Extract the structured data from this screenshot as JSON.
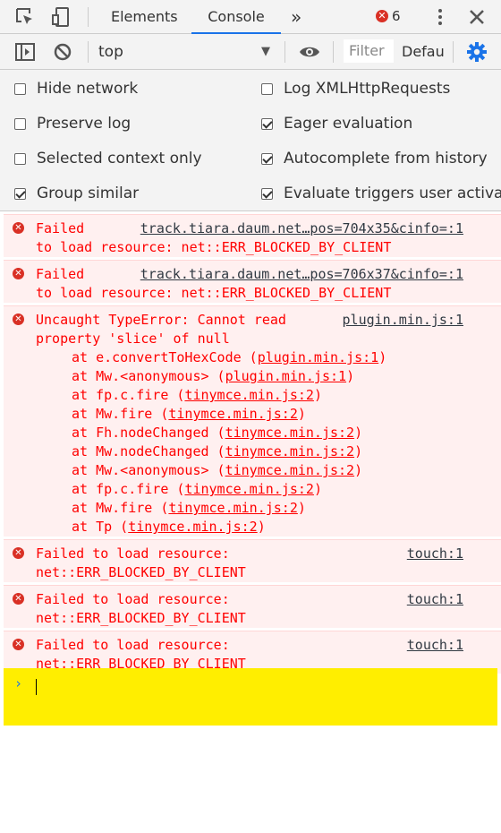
{
  "tabs": {
    "elements": "Elements",
    "console": "Console",
    "more": "»",
    "error_count": "6"
  },
  "toolbar": {
    "context": "top",
    "filter_placeholder": "Filter",
    "levels": "Defau"
  },
  "settings": {
    "hide_network": "Hide network",
    "preserve_log": "Preserve log",
    "selected_context": "Selected context only",
    "group_similar": "Group similar",
    "log_xhr": "Log XMLHttpRequests",
    "eager_eval": "Eager evaluation",
    "autocomplete": "Autocomplete from history",
    "eval_triggers": "Evaluate triggers user activation"
  },
  "messages": {
    "m1": {
      "line1": "Failed",
      "source": "track.tiara.daum.net…pos=704x35&cinfo=:1",
      "line2": "to load resource: net::ERR_BLOCKED_BY_CLIENT"
    },
    "m2": {
      "line1": "Failed",
      "source": "track.tiara.daum.net…pos=706x37&cinfo=:1",
      "line2": "to load resource: net::ERR_BLOCKED_BY_CLIENT"
    },
    "m3": {
      "line1": "Uncaught TypeError: Cannot read",
      "source": "plugin.min.js:1",
      "line2": "property 'slice' of null",
      "trace": [
        {
          "fn": "at e.convertToHexCode (",
          "link": "plugin.min.js:1",
          "end": ")"
        },
        {
          "fn": "at Mw.<anonymous> (",
          "link": "plugin.min.js:1",
          "end": ")"
        },
        {
          "fn": "at fp.c.fire (",
          "link": "tinymce.min.js:2",
          "end": ")"
        },
        {
          "fn": "at Mw.fire (",
          "link": "tinymce.min.js:2",
          "end": ")"
        },
        {
          "fn": "at Fh.nodeChanged (",
          "link": "tinymce.min.js:2",
          "end": ")"
        },
        {
          "fn": "at Mw.nodeChanged (",
          "link": "tinymce.min.js:2",
          "end": ")"
        },
        {
          "fn": "at Mw.<anonymous> (",
          "link": "tinymce.min.js:2",
          "end": ")"
        },
        {
          "fn": "at fp.c.fire (",
          "link": "tinymce.min.js:2",
          "end": ")"
        },
        {
          "fn": "at Mw.fire (",
          "link": "tinymce.min.js:2",
          "end": ")"
        },
        {
          "fn": "at Tp (",
          "link": "tinymce.min.js:2",
          "end": ")"
        }
      ]
    },
    "m4": {
      "line1": "Failed to load resource:",
      "source": "touch:1",
      "line2": "net::ERR_BLOCKED_BY_CLIENT"
    },
    "m5": {
      "line1": "Failed to load resource:",
      "source": "touch:1",
      "line2": "net::ERR_BLOCKED_BY_CLIENT"
    },
    "m6": {
      "line1": "Failed to load resource:",
      "source": "touch:1",
      "line2": "net::ERR_BLOCKED_BY_CLIENT"
    }
  },
  "prompt": {
    "caret": "›"
  },
  "colors": {
    "error_text": "#ff0000",
    "error_bg": "#fff0f0",
    "accent": "#1a73e8",
    "highlight": "#ffee00"
  },
  "icons": [
    "inspect-element-icon",
    "device-toolbar-icon",
    "error-icon",
    "kebab-menu-icon",
    "close-icon",
    "sidebar-toggle-icon",
    "clear-console-icon",
    "dropdown-arrow-icon",
    "eye-icon",
    "gear-icon"
  ]
}
